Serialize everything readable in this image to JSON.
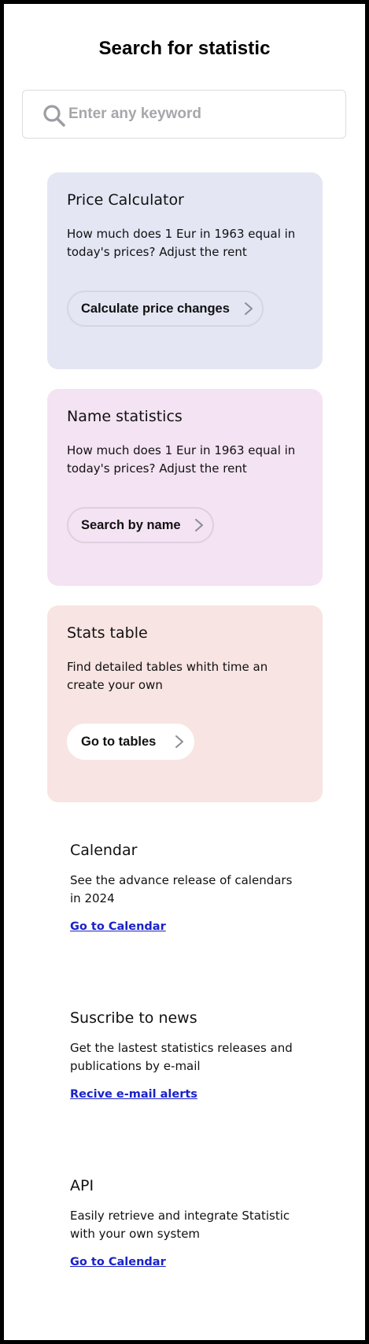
{
  "header": {
    "title": "Search for statistic"
  },
  "search": {
    "placeholder": "Enter any keyword",
    "value": "",
    "icon": "search-icon"
  },
  "cards": [
    {
      "title": "Price Calculator",
      "description": "How much does 1 Eur in 1963 equal in today's prices? Adjust the rent",
      "button_label": "Calculate price changes",
      "background": "#e4e6f4"
    },
    {
      "title": "Name statistics",
      "description": "How much does 1 Eur in 1963 equal in today's prices? Adjust the rent",
      "button_label": "Search by name",
      "background": "#f4e3f3"
    },
    {
      "title": "Stats table",
      "description": "Find detailed tables whith time an create your own",
      "button_label": "Go to tables",
      "background": "#f8e4e2"
    }
  ],
  "sections": [
    {
      "title": "Calendar",
      "description": "See the advance release of calendars in 2024",
      "link_label": "Go to Calendar"
    },
    {
      "title": "Suscribe to news",
      "description": "Get the lastest statistics releases and publications by e-mail",
      "link_label": "Recive e-mail alerts"
    },
    {
      "title": "API",
      "description": "Easily retrieve and integrate Statistic with your own system",
      "link_label": "Go to Calendar"
    }
  ],
  "colors": {
    "link": "#1a22c8",
    "border": "#000000"
  }
}
